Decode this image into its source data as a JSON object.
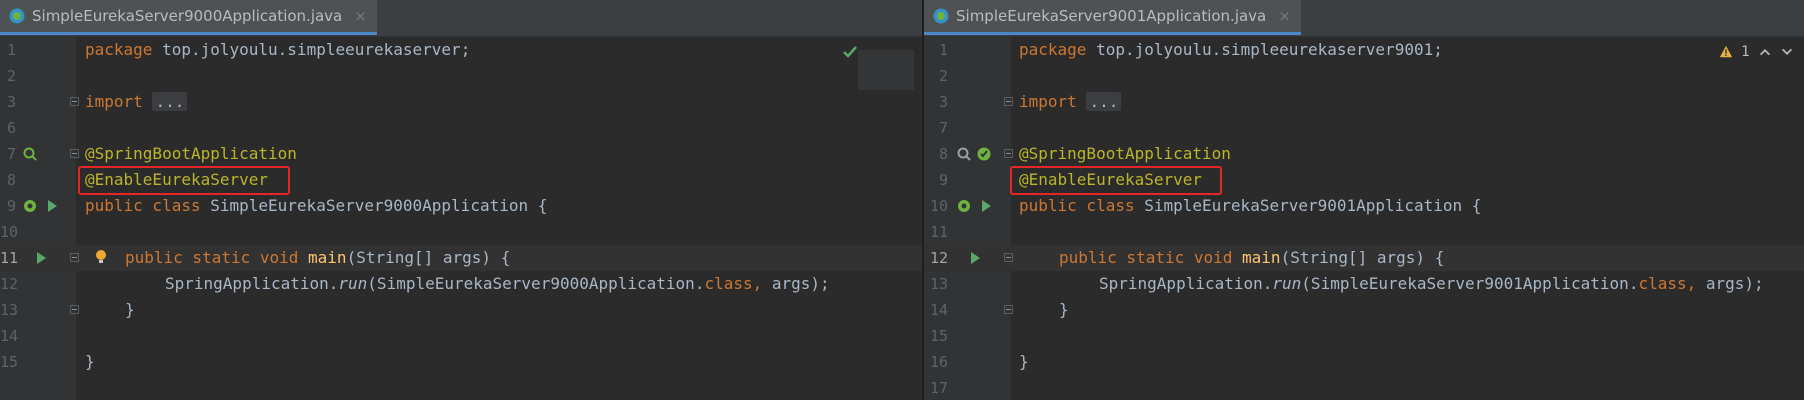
{
  "editor": {
    "left": {
      "tab_title": "SimpleEurekaServer9000Application.java",
      "tab_close": "×",
      "line_numbers": [
        "1",
        "2",
        "3",
        "6",
        "7",
        "8",
        "9",
        "10",
        "11",
        "12",
        "13",
        "14",
        "15"
      ],
      "code": {
        "l1_kw": "package",
        "l1_rest": " top.jolyoulu.simpleeurekaserver;",
        "l3_kw": "import",
        "l3_fold": "...",
        "l7_ann": "@SpringBootApplication",
        "l8_ann": "@EnableEurekaServer",
        "l9_kw": "public class",
        "l9_rest": " SimpleEurekaServer9000Application {",
        "l11_kw": "public static void",
        "l11_fn": "main",
        "l11_rest": "(String[] args) {",
        "l12_prefix": "SpringApplication.",
        "l12_run": "run",
        "l12_mid": "(SimpleEurekaServer9000Application.",
        "l12_class": "class,",
        "l12_end": " args);",
        "l13_brace": "}",
        "l15_brace": "}"
      }
    },
    "right": {
      "tab_title": "SimpleEurekaServer9001Application.java",
      "tab_close": "×",
      "warning_count": "1",
      "line_numbers": [
        "1",
        "2",
        "3",
        "7",
        "8",
        "9",
        "10",
        "11",
        "12",
        "13",
        "14",
        "15",
        "16",
        "17"
      ],
      "code": {
        "l1_kw": "package",
        "l1_rest": " top.jolyoulu.simpleeurekaserver9001;",
        "l3_kw": "import",
        "l3_fold": "...",
        "l8_ann": "@SpringBootApplication",
        "l9_ann": "@EnableEurekaServer",
        "l10_kw": "public class",
        "l10_rest": " SimpleEurekaServer9001Application {",
        "l12_kw": "public static void",
        "l12_fn": "main",
        "l12_rest": "(String[] args) {",
        "l13_prefix": "SpringApplication.",
        "l13_run": "run",
        "l13_mid": "(SimpleEurekaServer9001Application.",
        "l13_class": "class,",
        "l13_end": " args);",
        "l14_brace": "}",
        "l16_brace": "}"
      }
    }
  },
  "colors": {
    "keyword": "#cc7832",
    "annotation": "#bbb529",
    "function": "#ffc66d",
    "text": "#a9b7c6",
    "highlight_box": "#e62626"
  },
  "icons": [
    "spring-bean-icon",
    "run-icon",
    "intention-bulb-icon",
    "check-icon",
    "warning-icon",
    "arrow-up-icon",
    "arrow-down-icon"
  ]
}
